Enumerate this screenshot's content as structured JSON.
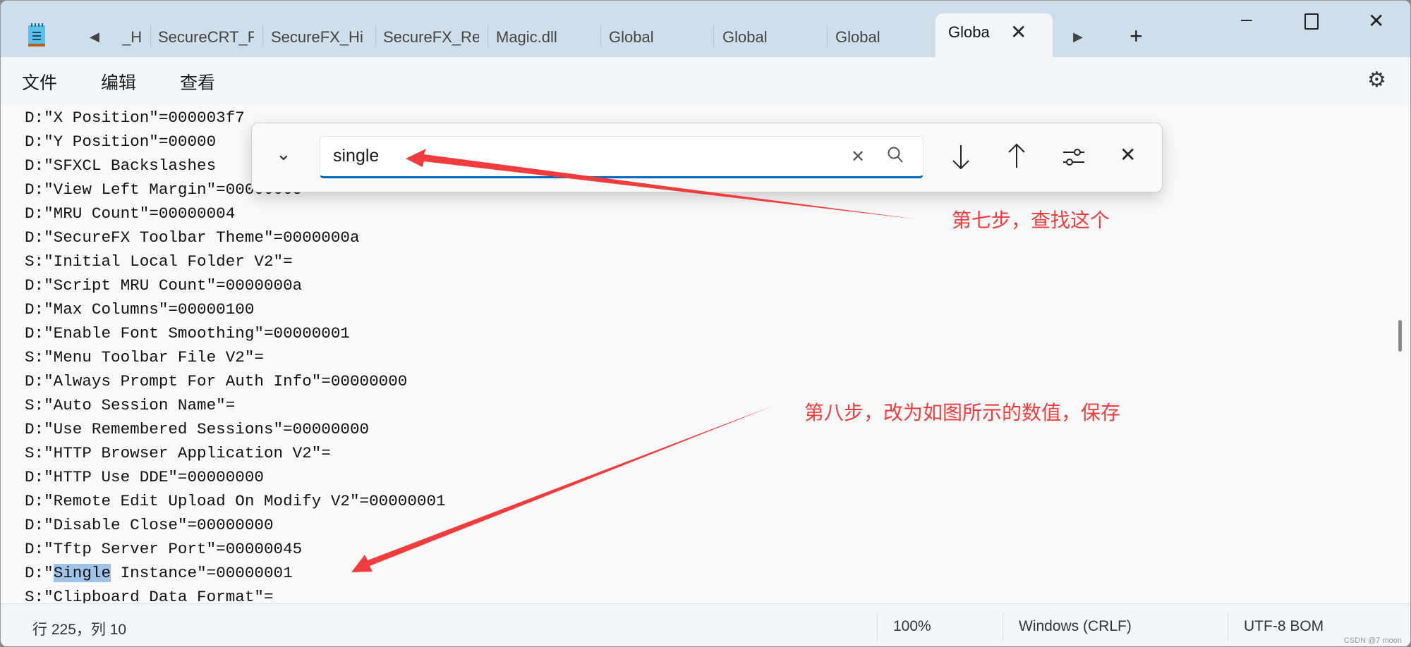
{
  "app": {
    "icon": "notepad-icon"
  },
  "tabs": {
    "scroll_left_icon": "caret-left-icon",
    "scroll_right_icon": "caret-right-icon",
    "items": [
      {
        "label": "_H"
      },
      {
        "label": "SecureCRT_F"
      },
      {
        "label": "SecureFX_Hi"
      },
      {
        "label": "SecureFX_Re"
      },
      {
        "label": "Magic.dll"
      },
      {
        "label": "Global"
      },
      {
        "label": "Global"
      },
      {
        "label": "Global"
      }
    ],
    "active": {
      "label": "Globa"
    },
    "new_tab_icon": "plus-icon"
  },
  "window_controls": {
    "minimize": "minimize-icon",
    "maximize": "maximize-icon",
    "close": "close-icon"
  },
  "menu": {
    "items": [
      {
        "label": "文件"
      },
      {
        "label": "编辑"
      },
      {
        "label": "查看"
      }
    ],
    "settings_icon": "gear-icon"
  },
  "editor": {
    "lines": [
      {
        "text": "D:\"X Position\"=000003f7"
      },
      {
        "text": "D:\"Y Position\"=00000"
      },
      {
        "text": "D:\"SFXCL Backslashes"
      },
      {
        "text": "D:\"View Left Margin\"=00000005"
      },
      {
        "text": "D:\"MRU Count\"=00000004"
      },
      {
        "text": "D:\"SecureFX Toolbar Theme\"=0000000a"
      },
      {
        "text": "S:\"Initial Local Folder V2\"="
      },
      {
        "text": "D:\"Script MRU Count\"=0000000a"
      },
      {
        "text": "D:\"Max Columns\"=00000100"
      },
      {
        "text": "D:\"Enable Font Smoothing\"=00000001"
      },
      {
        "text": "S:\"Menu Toolbar File V2\"="
      },
      {
        "text": "D:\"Always Prompt For Auth Info\"=00000000"
      },
      {
        "text": "S:\"Auto Session Name\"="
      },
      {
        "text": "D:\"Use Remembered Sessions\"=00000000"
      },
      {
        "text": "S:\"HTTP Browser Application V2\"="
      },
      {
        "text": "D:\"HTTP Use DDE\"=00000000"
      },
      {
        "text": "D:\"Remote Edit Upload On Modify V2\"=00000001"
      },
      {
        "text": "D:\"Disable Close\"=00000000"
      },
      {
        "text": "D:\"Tftp Server Port\"=00000045"
      },
      {
        "before": "D:\"",
        "match": "Single",
        "after": " Instance\"=00000001"
      },
      {
        "text": "S:\"Clipboard Data Format\"="
      }
    ],
    "highlight_color": "#9ec3e6"
  },
  "find": {
    "value": "single",
    "toggle_icon": "chevron-down-icon",
    "clear_icon": "close-icon",
    "search_icon": "search-icon",
    "next_icon": "arrow-down-icon",
    "prev_icon": "arrow-up-icon",
    "options_icon": "sliders-icon",
    "close_icon": "close-icon"
  },
  "annotations": {
    "step7": "第七步，查找这个",
    "step8": "第八步，改为如图所示的数值，保存",
    "color": "#f03c3c"
  },
  "status": {
    "position": "行 225，列 10",
    "zoom": "100%",
    "line_ending": "Windows (CRLF)",
    "encoding": "UTF-8 BOM"
  },
  "watermark": "CSDN @7 moon"
}
